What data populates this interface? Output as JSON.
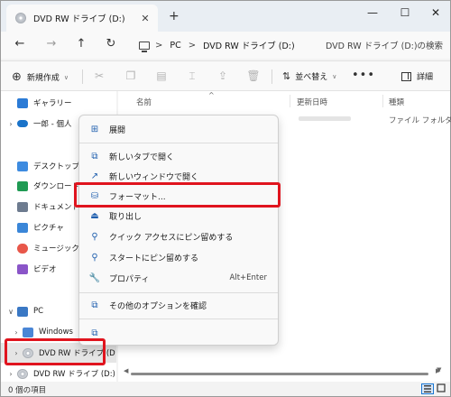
{
  "window": {
    "tab_title": "DVD RW ドライブ (D:)",
    "close_tab": "✕",
    "new_tab": "+",
    "minimize": "—",
    "maximize": "☐",
    "close": "✕"
  },
  "nav": {
    "back": "←",
    "forward": "→",
    "up": "↑",
    "refresh": "↻",
    "breadcrumb": [
      "PC",
      "DVD RW ドライブ (D:)"
    ],
    "breadcrumb_sep": ">",
    "search_placeholder": "DVD RW ドライブ (D:)の検索"
  },
  "toolbar": {
    "new_label": "新規作成",
    "sort_label": "並べ替え",
    "more": "•••",
    "details_label": "詳細",
    "icons": [
      "cut-icon",
      "copy-icon",
      "paste-icon",
      "rename-icon",
      "share-icon",
      "delete-icon"
    ]
  },
  "columns": {
    "name": "名前",
    "date": "更新日時",
    "type": "種類"
  },
  "rows": [
    {
      "type": "ファイル フォルダー"
    }
  ],
  "sidebar": {
    "items": [
      {
        "label": "ギャラリー",
        "icon": "gallery-icon",
        "color": "#2b7bd6"
      },
      {
        "label": "一郎 - 個人",
        "icon": "onedrive-icon",
        "color": "#1a73c9",
        "expandable": true
      },
      {
        "label": "デスクトップ",
        "icon": "desktop-icon",
        "color": "#3d8be0"
      },
      {
        "label": "ダウンロード",
        "icon": "download-icon",
        "color": "#1f9a53"
      },
      {
        "label": "ドキュメント",
        "icon": "documents-icon",
        "color": "#6d7b8f"
      },
      {
        "label": "ピクチャ",
        "icon": "pictures-icon",
        "color": "#3a86d8"
      },
      {
        "label": "ミュージック",
        "icon": "music-icon",
        "color": "#e8574a"
      },
      {
        "label": "ビデオ",
        "icon": "videos-icon",
        "color": "#8a55c8"
      },
      {
        "label": "PC",
        "icon": "pc-icon",
        "color": "#3a78c4",
        "expanded": true
      },
      {
        "label": "Windows",
        "icon": "windows-drive-icon",
        "color": "#4a86d6",
        "expandable": true
      },
      {
        "label": "DVD RW ドライブ (D",
        "icon": "dvd-icon",
        "color": "#b9bec5",
        "expandable": true,
        "selected": true
      },
      {
        "label": "DVD RW ドライブ (D:)",
        "icon": "dvd-icon",
        "color": "#b9bec5",
        "expandable": true
      }
    ]
  },
  "context_menu": {
    "items": [
      {
        "label": "展開",
        "icon": "expand-icon",
        "glyph": "⊞"
      },
      {
        "label": "新しいタブで開く",
        "icon": "new-tab-icon",
        "glyph": "⧉"
      },
      {
        "label": "新しいウィンドウで開く",
        "icon": "new-window-icon",
        "glyph": "↗"
      },
      {
        "label": "フォーマット...",
        "icon": "format-icon",
        "glyph": "⛁",
        "highlighted": true
      },
      {
        "label": "取り出し",
        "icon": "eject-icon",
        "glyph": "⏏"
      },
      {
        "label": "クイック アクセスにピン留めする",
        "icon": "pin-icon",
        "glyph": "⚲"
      },
      {
        "label": "スタートにピン留めする",
        "icon": "pin-start-icon",
        "glyph": "⚲"
      },
      {
        "label": "プロパティ",
        "icon": "properties-icon",
        "glyph": "🔧",
        "shortcut": "Alt+Enter"
      },
      {
        "label": "その他のオプションを確認",
        "icon": "more-options-icon",
        "glyph": "⧉"
      },
      {
        "label": "",
        "icon": "copy-icon",
        "glyph": "⧉"
      }
    ]
  },
  "status": {
    "count_text": "0 個の項目"
  },
  "accent": {
    "highlight": "#e0141e",
    "selection": "#1976d2"
  }
}
